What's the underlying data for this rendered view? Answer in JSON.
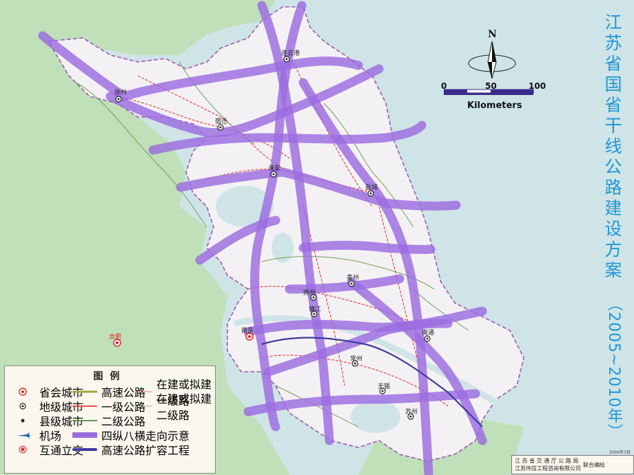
{
  "title": {
    "main": "江苏省国省干线公路建设方案",
    "sub": "（2005~2010年）"
  },
  "scale": {
    "north": "N",
    "ticks": [
      "0",
      "50",
      "100"
    ],
    "unit": "Kilometers"
  },
  "legend": {
    "heading": "图例",
    "items": [
      {
        "label": "省会城市",
        "symbol": "provincial-capital-icon"
      },
      {
        "label": "地级城市",
        "symbol": "prefecture-city-icon"
      },
      {
        "label": "县级城市",
        "symbol": "county-city-icon"
      },
      {
        "label": "机场",
        "symbol": "airport-icon"
      },
      {
        "label": "互通立交",
        "symbol": "interchange-icon"
      },
      {
        "label": "高速公路",
        "symbol": "expressway-line",
        "color": "#9aa83a"
      },
      {
        "label": "一级公路",
        "symbol": "first-class-road-line",
        "color": "#e43b3b"
      },
      {
        "label": "二级公路",
        "symbol": "second-class-road-line",
        "color": "#4f8a3a"
      },
      {
        "label": "四纵八横走向示意",
        "symbol": "corridor-band",
        "color": "#9b6be0"
      },
      {
        "label": "高速公路扩容工程",
        "symbol": "expressway-expansion-line",
        "color": "#3b3aa0"
      },
      {
        "label": "在建或拟建一级路",
        "symbol": "planned-first-class-line",
        "color": "#e43b3b"
      },
      {
        "label": "在建或拟建二级路",
        "symbol": "planned-second-class-line",
        "color": "#4f8a3a"
      }
    ]
  },
  "credit": {
    "org1": "江 苏 省 交 通 厅 公 路 局",
    "org2": "江苏伟信工程咨询有限公司",
    "tail": "联合编绘",
    "year": "2006年3月"
  },
  "cities": [
    {
      "name": "徐州",
      "kind": "prefecture"
    },
    {
      "name": "连云港",
      "kind": "prefecture"
    },
    {
      "name": "宿迁",
      "kind": "prefecture"
    },
    {
      "name": "淮安",
      "kind": "prefecture"
    },
    {
      "name": "盐城",
      "kind": "prefecture"
    },
    {
      "name": "扬州",
      "kind": "prefecture"
    },
    {
      "name": "泰州",
      "kind": "prefecture"
    },
    {
      "name": "南通",
      "kind": "prefecture"
    },
    {
      "name": "镇江",
      "kind": "prefecture"
    },
    {
      "name": "南京",
      "kind": "provincial"
    },
    {
      "name": "常州",
      "kind": "prefecture"
    },
    {
      "name": "无锡",
      "kind": "prefecture"
    },
    {
      "name": "苏州",
      "kind": "prefecture"
    },
    {
      "name": "合肥",
      "kind": "provincial"
    }
  ],
  "colors": {
    "sea": "#cfe4e6",
    "province": "#f4f1f4",
    "neighbor": "#bfe0b8",
    "corridor": "#9b6be0",
    "title": "#1f97d6"
  }
}
